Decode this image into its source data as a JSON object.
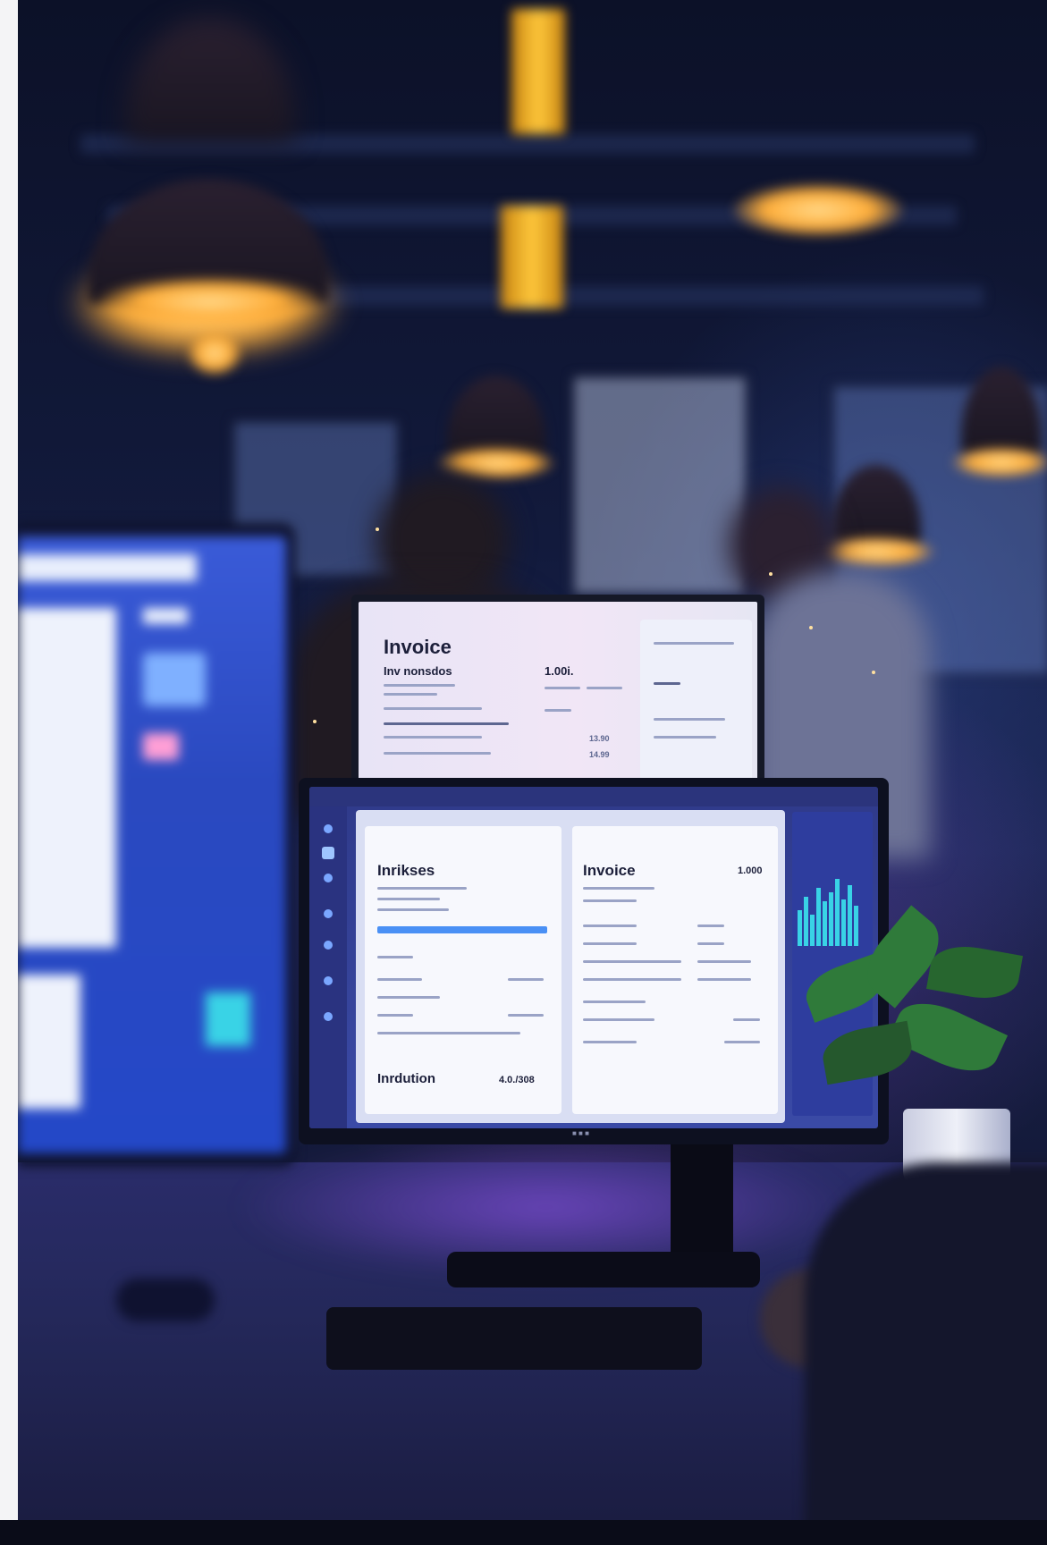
{
  "scene": {
    "description_free": true
  },
  "back_monitor": {
    "title": "Invoice",
    "subtitle": "Inv nonsdos",
    "amount": "1.00i.",
    "row_values": [
      "13.90",
      "14.99"
    ]
  },
  "front_monitor": {
    "left_card": {
      "title": "Inrikses",
      "footer_title": "Inrdution",
      "footer_amount": "4.0./308"
    },
    "right_card": {
      "title": "Invoice",
      "amount": "1.000"
    },
    "bottom_label": "■ ■ ■"
  },
  "colors": {
    "lamp": "#ffae3a",
    "screen_glow": "#c78bff",
    "accent_blue": "#3a5bd8",
    "chart_cyan": "#39d3e6"
  }
}
